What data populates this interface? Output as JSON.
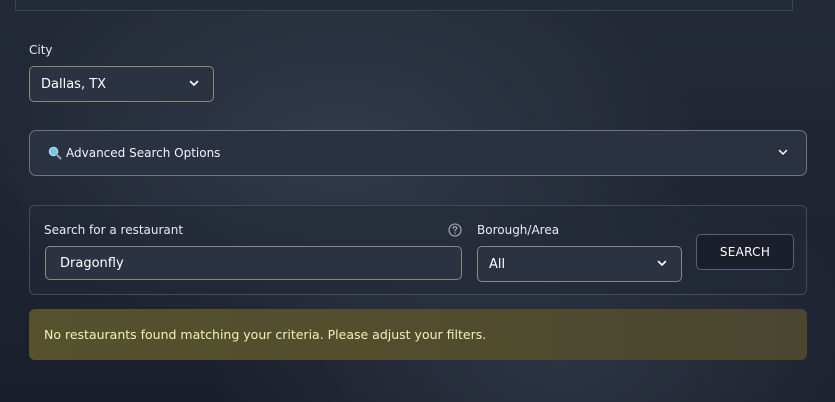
{
  "city": {
    "label": "City",
    "selected": "Dallas, TX"
  },
  "advanced_search": {
    "icon": "magnifier-icon",
    "label": "Advanced Search Options"
  },
  "search": {
    "label": "Search for a restaurant",
    "value": "Dragonfly",
    "help_icon": "question-circle-icon"
  },
  "borough": {
    "label": "Borough/Area",
    "selected": "All"
  },
  "search_button": {
    "label": "SEARCH"
  },
  "alert": {
    "message": "No restaurants found matching your criteria. Please adjust your filters."
  },
  "colors": {
    "alert_text": "#f7efb4",
    "alert_bg": "#55522e",
    "field_border": "#8d8a73"
  }
}
